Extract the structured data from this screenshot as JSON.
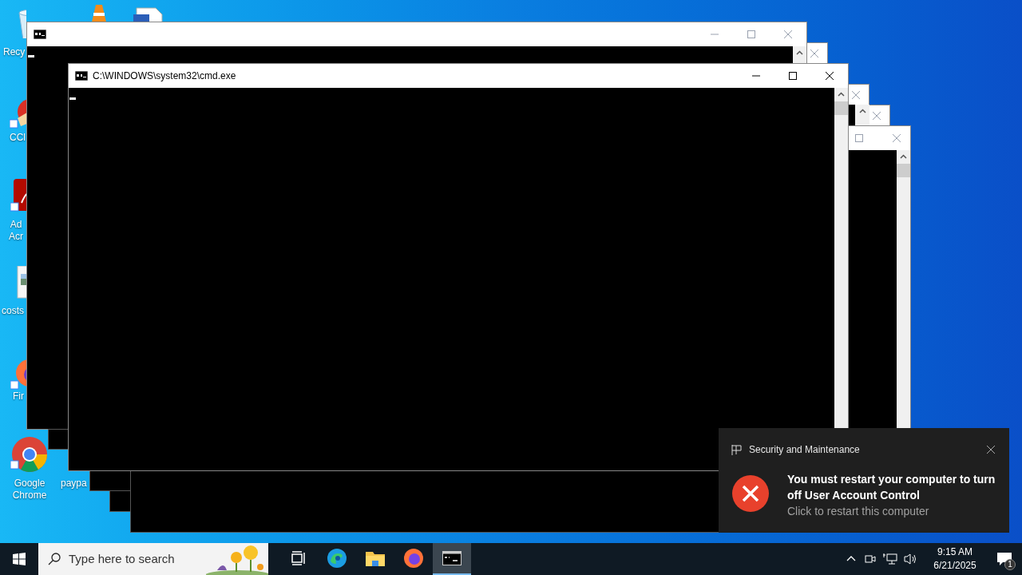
{
  "desktop_icons": [
    {
      "kind": "recycle-bin",
      "label": "Recy"
    },
    {
      "kind": "cone"
    },
    {
      "kind": "document"
    },
    {
      "kind": "cleaner",
      "label": "CCl"
    },
    {
      "kind": "acrobat",
      "label": "Ad Acr"
    },
    {
      "kind": "image",
      "label": "costs"
    },
    {
      "kind": "firefox",
      "label": "Fir"
    },
    {
      "kind": "chrome",
      "label": "Google Chrome"
    },
    {
      "kind": "hidden",
      "label": "paypa"
    }
  ],
  "windows": [
    {
      "active": false
    },
    {
      "active": true,
      "title": "C:\\WINDOWS\\system32\\cmd.exe"
    }
  ],
  "notification": {
    "app": "Security and Maintenance",
    "title": "You must restart your computer to turn off User Account Control",
    "body": "Click to restart this computer"
  },
  "taskbar": {
    "search": {
      "placeholder": "Type here to search"
    },
    "apps": [
      {
        "kind": "task-view",
        "selected": false
      },
      {
        "kind": "edge",
        "selected": false
      },
      {
        "kind": "explorer",
        "selected": false
      },
      {
        "kind": "firefox",
        "selected": false
      },
      {
        "kind": "cmd",
        "selected": true
      }
    ],
    "time": "9:15 AM",
    "date": "6/21/2025",
    "notification_count": "1"
  }
}
